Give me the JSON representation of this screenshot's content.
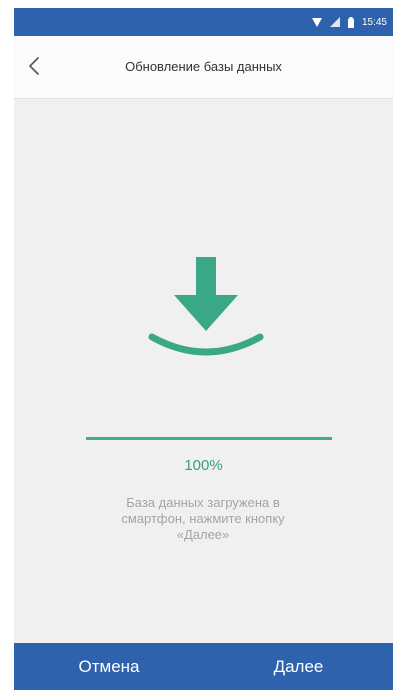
{
  "status_bar": {
    "time": "15:45",
    "icons": [
      "wifi-icon",
      "signal-icon",
      "battery-icon"
    ]
  },
  "header": {
    "title": "Обновление базы данных",
    "back_icon": "chevron-left-icon"
  },
  "main": {
    "icon": "download-icon",
    "progress": {
      "value": 1.0,
      "label": "100%"
    },
    "message": "База данных загружена в\nсмартфон, нажмите кнопку\n«Далее»"
  },
  "footer": {
    "cancel_label": "Отмена",
    "next_label": "Далее"
  },
  "colors": {
    "primary": "#2e62ad",
    "accent": "#3aa886",
    "background": "#f0f0f0",
    "muted_text": "#a4a4a4"
  }
}
